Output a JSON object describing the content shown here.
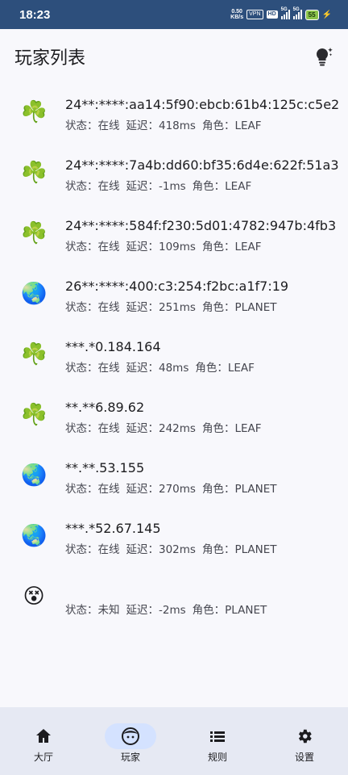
{
  "statusbar": {
    "time": "18:23",
    "net_speed_value": "0.50",
    "net_speed_unit": "KB/s",
    "vpn": "VPN",
    "hd": "HD",
    "sig1": "5G",
    "sig2": "5G",
    "battery": "55"
  },
  "header": {
    "title": "玩家列表",
    "action_icon": "lightbulb-icon"
  },
  "labels": {
    "status": "状态：",
    "latency": "延迟：",
    "role": "角色："
  },
  "players": [
    {
      "icon": "shamrock-icon",
      "emoji": "☘️",
      "address": "24**:****:aa14:5f90:ebcb:61b4:125c:c5e2",
      "status": "在线",
      "latency": "418ms",
      "role": "LEAF"
    },
    {
      "icon": "shamrock-icon",
      "emoji": "☘️",
      "address": "24**:****:7a4b:dd60:bf35:6d4e:622f:51a3",
      "status": "在线",
      "latency": "-1ms",
      "role": "LEAF"
    },
    {
      "icon": "shamrock-icon",
      "emoji": "☘️",
      "address": "24**:****:584f:f230:5d01:4782:947b:4fb3",
      "status": "在线",
      "latency": "109ms",
      "role": "LEAF"
    },
    {
      "icon": "globe-icon",
      "emoji": "🌏",
      "address": "26**:****:400:c3:254:f2bc:a1f7:19",
      "status": "在线",
      "latency": "251ms",
      "role": "PLANET"
    },
    {
      "icon": "shamrock-icon",
      "emoji": "☘️",
      "address": "***.*0.184.164",
      "status": "在线",
      "latency": "48ms",
      "role": "LEAF"
    },
    {
      "icon": "shamrock-icon",
      "emoji": "☘️",
      "address": "**.**6.89.62",
      "status": "在线",
      "latency": "242ms",
      "role": "LEAF"
    },
    {
      "icon": "globe-icon",
      "emoji": "🌏",
      "address": "**.**.53.155",
      "status": "在线",
      "latency": "270ms",
      "role": "PLANET"
    },
    {
      "icon": "globe-icon",
      "emoji": "🌏",
      "address": "***.*52.67.145",
      "status": "在线",
      "latency": "302ms",
      "role": "PLANET"
    },
    {
      "icon": "dizzy-face-icon",
      "emoji": "😵",
      "address": "",
      "status": "未知",
      "latency": "-2ms",
      "role": "PLANET"
    }
  ],
  "nav": [
    {
      "label": "大厅",
      "icon": "home-icon",
      "active": false
    },
    {
      "label": "玩家",
      "icon": "face-icon",
      "active": true
    },
    {
      "label": "规则",
      "icon": "list-icon",
      "active": false
    },
    {
      "label": "设置",
      "icon": "gear-icon",
      "active": false
    }
  ],
  "colors": {
    "statusbar_bg": "#2d4f7c",
    "page_bg": "#f8f8fc",
    "navbar_bg": "#e6e9f3",
    "nav_active_pill": "#d4e2ff"
  }
}
